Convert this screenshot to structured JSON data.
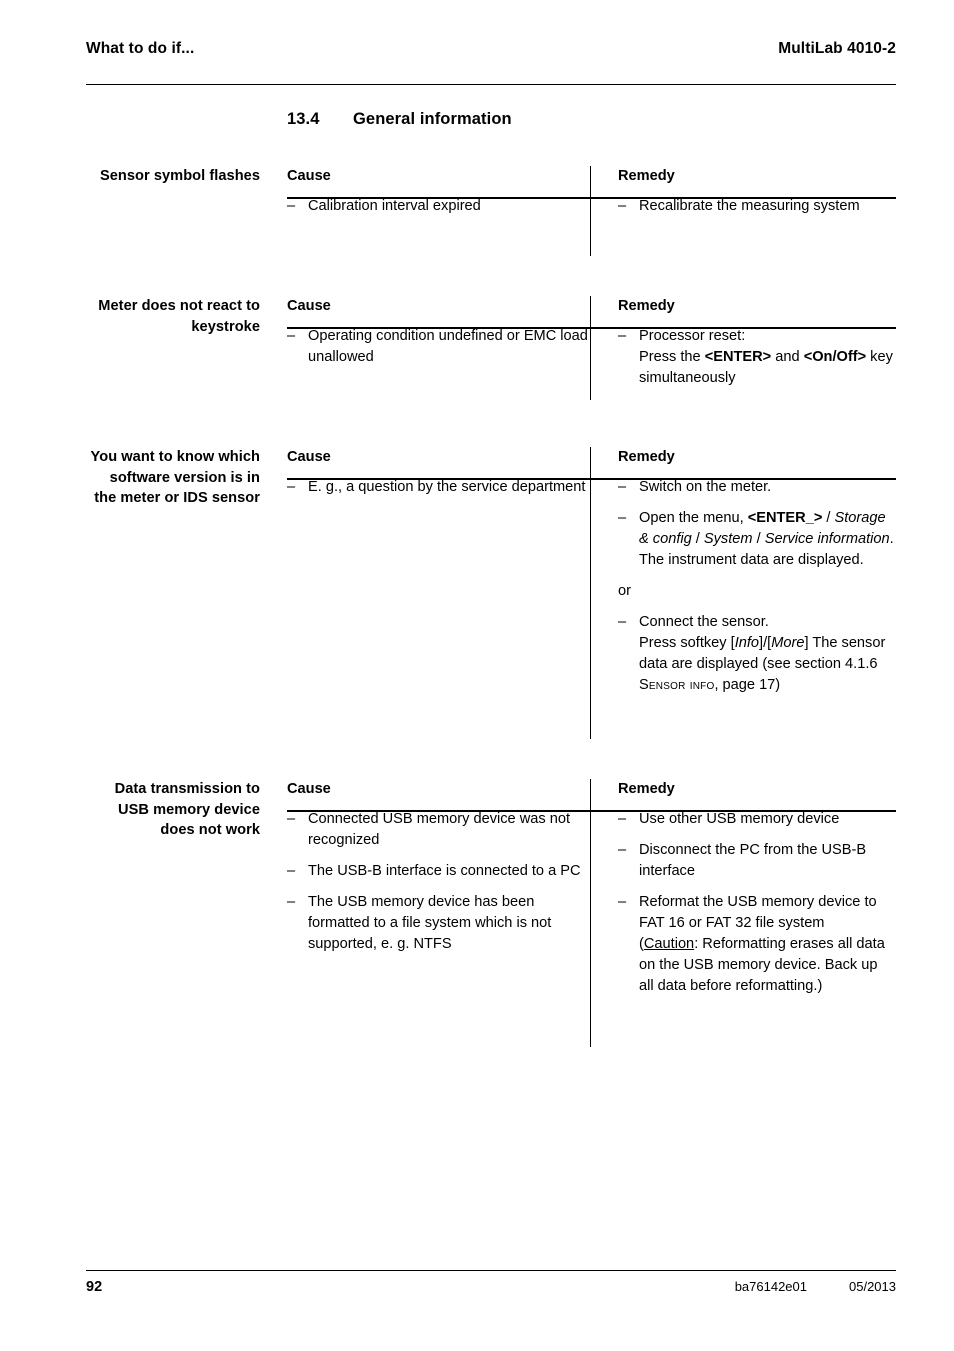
{
  "header": {
    "left": "What to do if...",
    "right": "MultiLab 4010-2"
  },
  "heading": {
    "number": "13.4",
    "title": "General information"
  },
  "table_headers": {
    "cause": "Cause",
    "remedy": "Remedy"
  },
  "dash": "–",
  "sections": [
    {
      "label": "Sensor symbol flashes",
      "cause": {
        "items": [
          {
            "parts": [
              {
                "t": "Calibration interval expired",
                "s": "n"
              }
            ]
          }
        ]
      },
      "remedy": {
        "items": [
          {
            "parts": [
              {
                "t": "Recalibrate the measuring system",
                "s": "n"
              }
            ]
          }
        ]
      }
    },
    {
      "label": "Meter does not react to keystroke",
      "cause": {
        "items": [
          {
            "parts": [
              {
                "t": "Operating condition undefined or EMC load unallowed",
                "s": "n"
              }
            ]
          }
        ]
      },
      "remedy": {
        "items": [
          {
            "parts": [
              {
                "t": "Processor reset:",
                "s": "n"
              },
              {
                "t": "\n",
                "s": "br"
              },
              {
                "t": "Press the ",
                "s": "n"
              },
              {
                "t": "<ENTER>",
                "s": "b"
              },
              {
                "t": " and ",
                "s": "n"
              },
              {
                "t": "<On/Off>",
                "s": "b"
              },
              {
                "t": " key simultaneously",
                "s": "n"
              }
            ]
          }
        ]
      }
    },
    {
      "label": "You want to know which software version is in the meter or IDS sensor",
      "cause": {
        "items": [
          {
            "parts": [
              {
                "t": "E. g., a question by the service department",
                "s": "n"
              }
            ]
          }
        ]
      },
      "remedy": {
        "items": [
          {
            "parts": [
              {
                "t": "Switch on the meter.",
                "s": "n"
              }
            ]
          },
          {
            "parts": [
              {
                "t": "Open the menu, ",
                "s": "n"
              },
              {
                "t": "<ENTER_>",
                "s": "b"
              },
              {
                "t": " / ",
                "s": "n"
              },
              {
                "t": "Storage & config",
                "s": "i"
              },
              {
                "t": " / ",
                "s": "n"
              },
              {
                "t": "System",
                "s": "i"
              },
              {
                "t": " / ",
                "s": "n"
              },
              {
                "t": "Service information",
                "s": "i"
              },
              {
                "t": ". The instrument data are displayed.",
                "s": "n"
              }
            ]
          },
          {
            "plain": true,
            "parts": [
              {
                "t": "or",
                "s": "n"
              }
            ]
          },
          {
            "parts": [
              {
                "t": "Connect the sensor.",
                "s": "n"
              },
              {
                "t": "\n",
                "s": "br"
              },
              {
                "t": "Press softkey [",
                "s": "n"
              },
              {
                "t": "Info",
                "s": "i"
              },
              {
                "t": "]/[",
                "s": "n"
              },
              {
                "t": "More",
                "s": "i"
              },
              {
                "t": "] The sensor data are displayed (see section 4.1.6 ",
                "s": "n"
              },
              {
                "t": "Sensor info",
                "s": "sc"
              },
              {
                "t": ", page 17)",
                "s": "n"
              }
            ]
          }
        ]
      }
    },
    {
      "label": "Data transmission to USB memory device does not work",
      "cause": {
        "items": [
          {
            "parts": [
              {
                "t": "Connected USB memory device was not recognized",
                "s": "n"
              }
            ]
          },
          {
            "parts": [
              {
                "t": "The USB-B interface is connected to a PC",
                "s": "n"
              }
            ]
          },
          {
            "parts": [
              {
                "t": "The USB memory device has been formatted to a file system which is not supported, e. g. NTFS",
                "s": "n"
              }
            ]
          }
        ]
      },
      "remedy": {
        "items": [
          {
            "parts": [
              {
                "t": "Use other USB memory device",
                "s": "n"
              }
            ]
          },
          {
            "parts": [
              {
                "t": "Disconnect the PC from the USB-B interface",
                "s": "n"
              }
            ]
          },
          {
            "parts": [
              {
                "t": "Reformat the USB memory device to FAT 16 or FAT 32 file system",
                "s": "n"
              },
              {
                "t": "\n",
                "s": "br"
              },
              {
                "t": "(",
                "s": "n"
              },
              {
                "t": "Caution",
                "s": "u"
              },
              {
                "t": ": Reformatting erases all data on the USB memory device. Back up all data before reformatting.)",
                "s": "n"
              }
            ]
          }
        ]
      }
    }
  ],
  "footer": {
    "page_number": "92",
    "doc_code": "ba76142e01",
    "date": "05/2013"
  },
  "layout": {
    "section_tops": [
      166,
      296,
      447,
      779
    ],
    "divider_heights": [
      90,
      104,
      292,
      268
    ],
    "head_rule_offsets": [
      31,
      31,
      31,
      31
    ]
  }
}
